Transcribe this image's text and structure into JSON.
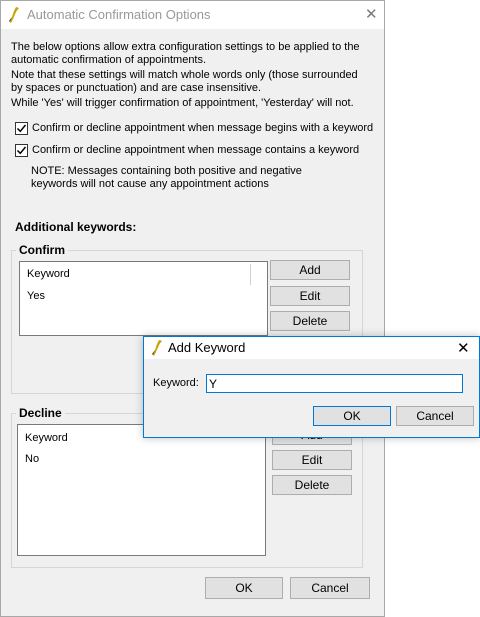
{
  "main": {
    "title": "Automatic Confirmation Options",
    "description": [
      "The below options allow extra configuration settings to be applied to the",
      "automatic confirmation of appointments.",
      "Note that these settings will match whole words only (those surrounded",
      "by spaces or punctuation) and are case insensitive.",
      "While 'Yes' will trigger confirmation of appointment, 'Yesterday' will not."
    ],
    "options": [
      {
        "label": "Confirm or decline appointment when message begins with a keyword",
        "checked": true
      },
      {
        "label": "Confirm or decline appointment when message contains a keyword",
        "checked": true
      }
    ],
    "note": [
      "NOTE: Messages containing both positive and negative",
      "keywords will not cause any appointment actions"
    ],
    "additional_heading": "Additional keywords:",
    "confirm_group": {
      "legend": "Confirm",
      "column_header": "Keyword",
      "items": [
        "Yes"
      ],
      "buttons": {
        "add": "Add",
        "edit": "Edit",
        "delete": "Delete"
      }
    },
    "decline_group": {
      "legend": "Decline",
      "column_header": "Keyword",
      "items": [
        "No"
      ],
      "buttons": {
        "add": "Add",
        "edit": "Edit",
        "delete": "Delete"
      }
    },
    "ok_label": "OK",
    "cancel_label": "Cancel"
  },
  "dialog": {
    "title": "Add Keyword",
    "field_label": "Keyword:",
    "field_value": "Y",
    "ok_label": "OK",
    "cancel_label": "Cancel"
  },
  "icons": {
    "app": "bird-icon",
    "close": "close-icon",
    "check": "checkmark-icon"
  },
  "colors": {
    "accent": "#0078d7",
    "window_bg": "#f0f0f0",
    "button_bg": "#e1e1e1"
  }
}
